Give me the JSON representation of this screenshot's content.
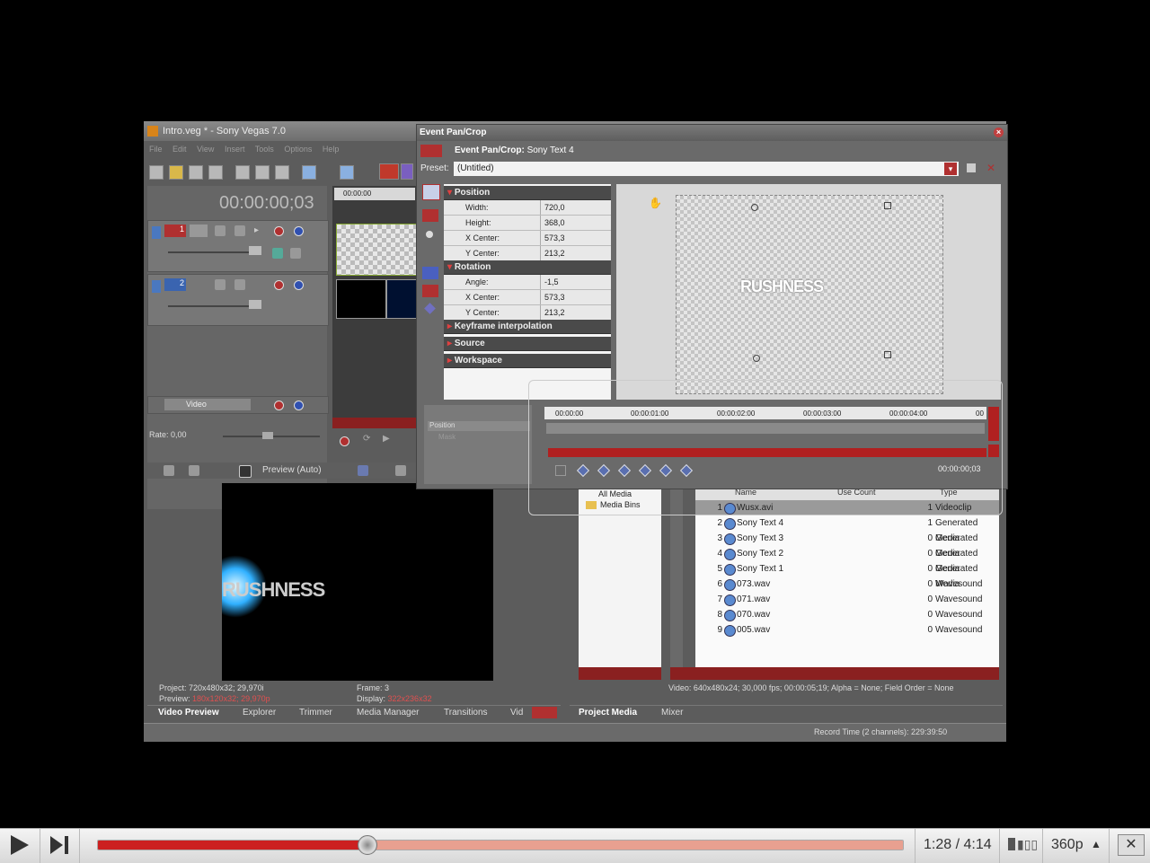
{
  "vegas": {
    "title": "Intro.veg * - Sony Vegas 7.0",
    "menu": [
      "File",
      "Edit",
      "View",
      "Insert",
      "Tools",
      "Options",
      "Help"
    ],
    "timecode": "00:00:00;03",
    "track1_num": "1",
    "track2_num": "2",
    "bus_label": "Video",
    "rate_label": "Rate: 0,00",
    "timeline_start": "00:00:00",
    "preview_label": "Preview (Auto)",
    "preview_text": "RUSHNESS",
    "project_info": "Project:  720x480x32; 29,970i",
    "preview_info_label": "Preview:",
    "preview_info_value": "180x120x32; 29,970p",
    "frame_info": "Frame:      3",
    "display_info_label": "Display:",
    "display_info_value": "322x236x32",
    "left_tabs": [
      "Video Preview",
      "Explorer",
      "Trimmer",
      "Media Manager",
      "Transitions",
      "Vid"
    ],
    "right_tabs": [
      "Project Media",
      "Mixer"
    ],
    "status": "Record Time (2 channels): 229:39:50",
    "media_tree": [
      "All Media",
      "Media Bins"
    ],
    "media_columns": [
      "Name",
      "Use Count",
      "Type"
    ],
    "media_rows": [
      {
        "n": "1",
        "name": "Wusx.avi",
        "count": "1",
        "type": "Videoclip"
      },
      {
        "n": "2",
        "name": "Sony Text 4",
        "count": "1",
        "type": "Generated Media"
      },
      {
        "n": "3",
        "name": "Sony Text 3",
        "count": "0",
        "type": "Generated Media"
      },
      {
        "n": "4",
        "name": "Sony Text 2",
        "count": "0",
        "type": "Generated Media"
      },
      {
        "n": "5",
        "name": "Sony Text 1",
        "count": "0",
        "type": "Generated Media"
      },
      {
        "n": "6",
        "name": "073.wav",
        "count": "0",
        "type": "Wavesound"
      },
      {
        "n": "7",
        "name": "071.wav",
        "count": "0",
        "type": "Wavesound"
      },
      {
        "n": "8",
        "name": "070.wav",
        "count": "0",
        "type": "Wavesound"
      },
      {
        "n": "9",
        "name": "005.wav",
        "count": "0",
        "type": "Wavesound"
      }
    ],
    "media_info": "Video: 640x480x24; 30,000 fps; 00:00:05;19; Alpha = None; Field Order = None"
  },
  "pancrop": {
    "title": "Event Pan/Crop",
    "event_label": "Event Pan/Crop:",
    "event_name": "Sony Text 4",
    "preset_label": "Preset:",
    "preset_value": "(Untitled)",
    "sections": {
      "position": "Position",
      "rotation": "Rotation",
      "keyframe": "Keyframe interpolation",
      "source": "Source",
      "workspace": "Workspace"
    },
    "position_props": [
      {
        "name": "Width:",
        "value": "720,0"
      },
      {
        "name": "Height:",
        "value": "368,0"
      },
      {
        "name": "X Center:",
        "value": "573,3"
      },
      {
        "name": "Y Center:",
        "value": "213,2"
      }
    ],
    "rotation_props": [
      {
        "name": "Angle:",
        "value": "-1,5"
      },
      {
        "name": "X Center:",
        "value": "573,3"
      },
      {
        "name": "Y Center:",
        "value": "213,2"
      }
    ],
    "canvas_text": "RUSHNESS",
    "kf_track_label": "Position",
    "kf_mask_label": "Mask",
    "ruler": [
      "00:00:00",
      "00:00:01:00",
      "00:00:02:00",
      "00:00:03:00",
      "00:00:04:00",
      "00"
    ],
    "kf_time": "00:00:00;03"
  },
  "player": {
    "time": "1:28 / 4:14",
    "quality": "360p",
    "progress": 0.35,
    "buffered": 1.0,
    "played_color": "#cc2020",
    "buffer_color": "#e8a090"
  }
}
